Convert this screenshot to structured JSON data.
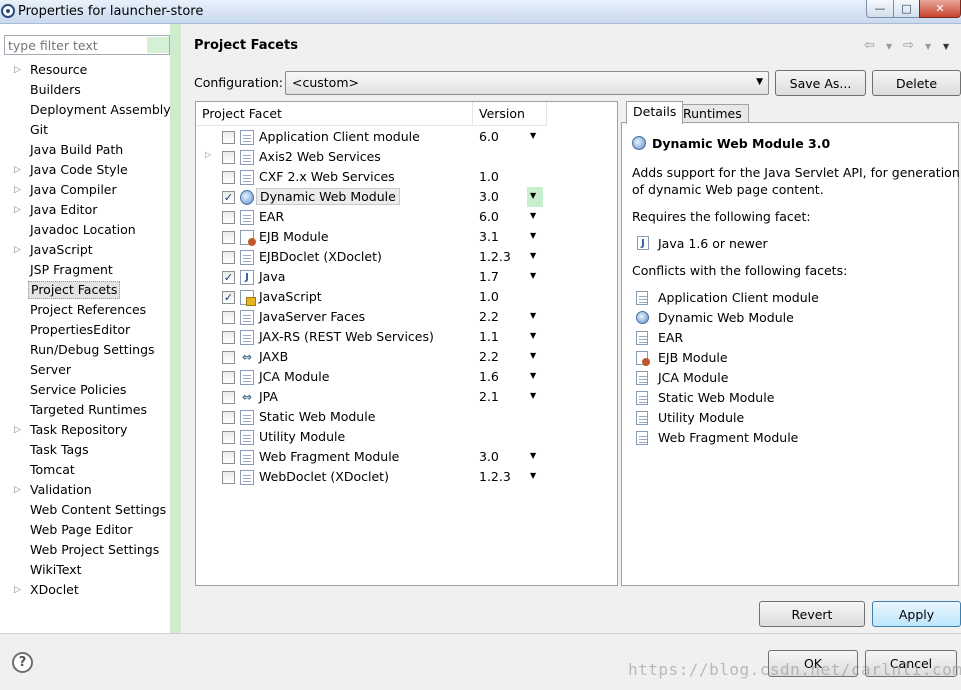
{
  "window": {
    "title": "Properties for launcher-store",
    "min_glyph": "—",
    "max_glyph": "□",
    "close_glyph": "✕"
  },
  "left": {
    "filter_placeholder": "type filter text",
    "items": [
      {
        "label": "Resource",
        "expandable": true
      },
      {
        "label": "Builders",
        "expandable": false
      },
      {
        "label": "Deployment Assembly",
        "expandable": false
      },
      {
        "label": "Git",
        "expandable": false
      },
      {
        "label": "Java Build Path",
        "expandable": false
      },
      {
        "label": "Java Code Style",
        "expandable": true
      },
      {
        "label": "Java Compiler",
        "expandable": true
      },
      {
        "label": "Java Editor",
        "expandable": true
      },
      {
        "label": "Javadoc Location",
        "expandable": false
      },
      {
        "label": "JavaScript",
        "expandable": true
      },
      {
        "label": "JSP Fragment",
        "expandable": false
      },
      {
        "label": "Project Facets",
        "expandable": false,
        "selected": true
      },
      {
        "label": "Project References",
        "expandable": false
      },
      {
        "label": "PropertiesEditor",
        "expandable": false
      },
      {
        "label": "Run/Debug Settings",
        "expandable": false
      },
      {
        "label": "Server",
        "expandable": false
      },
      {
        "label": "Service Policies",
        "expandable": false
      },
      {
        "label": "Targeted Runtimes",
        "expandable": false
      },
      {
        "label": "Task Repository",
        "expandable": true
      },
      {
        "label": "Task Tags",
        "expandable": false
      },
      {
        "label": "Tomcat",
        "expandable": false
      },
      {
        "label": "Validation",
        "expandable": true
      },
      {
        "label": "Web Content Settings",
        "expandable": false
      },
      {
        "label": "Web Page Editor",
        "expandable": false
      },
      {
        "label": "Web Project Settings",
        "expandable": false
      },
      {
        "label": "WikiText",
        "expandable": false
      },
      {
        "label": "XDoclet",
        "expandable": true
      }
    ]
  },
  "header": {
    "title": "Project Facets",
    "nav_icons": [
      "back-arrow-icon",
      "forward-arrow-icon",
      "menu-icon"
    ]
  },
  "config": {
    "label": "Configuration:",
    "value": "<custom>",
    "save_as_label": "Save As...",
    "delete_label": "Delete"
  },
  "facets": {
    "col_facet": "Project Facet",
    "col_version": "Version",
    "rows": [
      {
        "name": "Application Client module",
        "version": "6.0",
        "checked": false,
        "icon": "page",
        "dropdown": true
      },
      {
        "name": "Axis2 Web Services",
        "version": "",
        "checked": false,
        "icon": "page",
        "dropdown": false,
        "expandable": true
      },
      {
        "name": "CXF 2.x Web Services",
        "version": "1.0",
        "checked": false,
        "icon": "page",
        "dropdown": false
      },
      {
        "name": "Dynamic Web Module",
        "version": "3.0",
        "checked": true,
        "icon": "globe",
        "dropdown": true,
        "highlighted": true
      },
      {
        "name": "EAR",
        "version": "6.0",
        "checked": false,
        "icon": "page",
        "dropdown": true
      },
      {
        "name": "EJB Module",
        "version": "3.1",
        "checked": false,
        "icon": "ejb",
        "dropdown": true
      },
      {
        "name": "EJBDoclet (XDoclet)",
        "version": "1.2.3",
        "checked": false,
        "icon": "page",
        "dropdown": true
      },
      {
        "name": "Java",
        "version": "1.7",
        "checked": true,
        "icon": "java",
        "dropdown": true
      },
      {
        "name": "JavaScript",
        "version": "1.0",
        "checked": true,
        "icon": "js",
        "dropdown": false
      },
      {
        "name": "JavaServer Faces",
        "version": "2.2",
        "checked": false,
        "icon": "page",
        "dropdown": true
      },
      {
        "name": "JAX-RS (REST Web Services)",
        "version": "1.1",
        "checked": false,
        "icon": "page",
        "dropdown": true
      },
      {
        "name": "JAXB",
        "version": "2.2",
        "checked": false,
        "icon": "arrows",
        "dropdown": true
      },
      {
        "name": "JCA Module",
        "version": "1.6",
        "checked": false,
        "icon": "page",
        "dropdown": true
      },
      {
        "name": "JPA",
        "version": "2.1",
        "checked": false,
        "icon": "arrows",
        "dropdown": true
      },
      {
        "name": "Static Web Module",
        "version": "",
        "checked": false,
        "icon": "page",
        "dropdown": false
      },
      {
        "name": "Utility Module",
        "version": "",
        "checked": false,
        "icon": "page",
        "dropdown": false
      },
      {
        "name": "Web Fragment Module",
        "version": "3.0",
        "checked": false,
        "icon": "page",
        "dropdown": true
      },
      {
        "name": "WebDoclet (XDoclet)",
        "version": "1.2.3",
        "checked": false,
        "icon": "page",
        "dropdown": true
      }
    ]
  },
  "details": {
    "tab_details": "Details",
    "tab_runtimes": "Runtimes",
    "title": "Dynamic Web Module 3.0",
    "desc_line1": "Adds support for the Java Servlet API, for generation",
    "desc_line2": "of dynamic Web page content.",
    "requires_label": "Requires the following facet:",
    "requires_item": "Java 1.6 or newer",
    "conflicts_label": "Conflicts with the following facets:",
    "conflicts": [
      {
        "name": "Application Client module",
        "icon": "page"
      },
      {
        "name": "Dynamic Web Module",
        "icon": "globe"
      },
      {
        "name": "EAR",
        "icon": "page"
      },
      {
        "name": "EJB Module",
        "icon": "ejb"
      },
      {
        "name": "JCA Module",
        "icon": "page"
      },
      {
        "name": "Static Web Module",
        "icon": "page"
      },
      {
        "name": "Utility Module",
        "icon": "page"
      },
      {
        "name": "Web Fragment Module",
        "icon": "page"
      }
    ]
  },
  "buttons": {
    "revert": "Revert",
    "apply": "Apply",
    "ok": "OK",
    "cancel": "Cancel"
  },
  "watermark": "https://blog.csdn.net/carlnli.com"
}
